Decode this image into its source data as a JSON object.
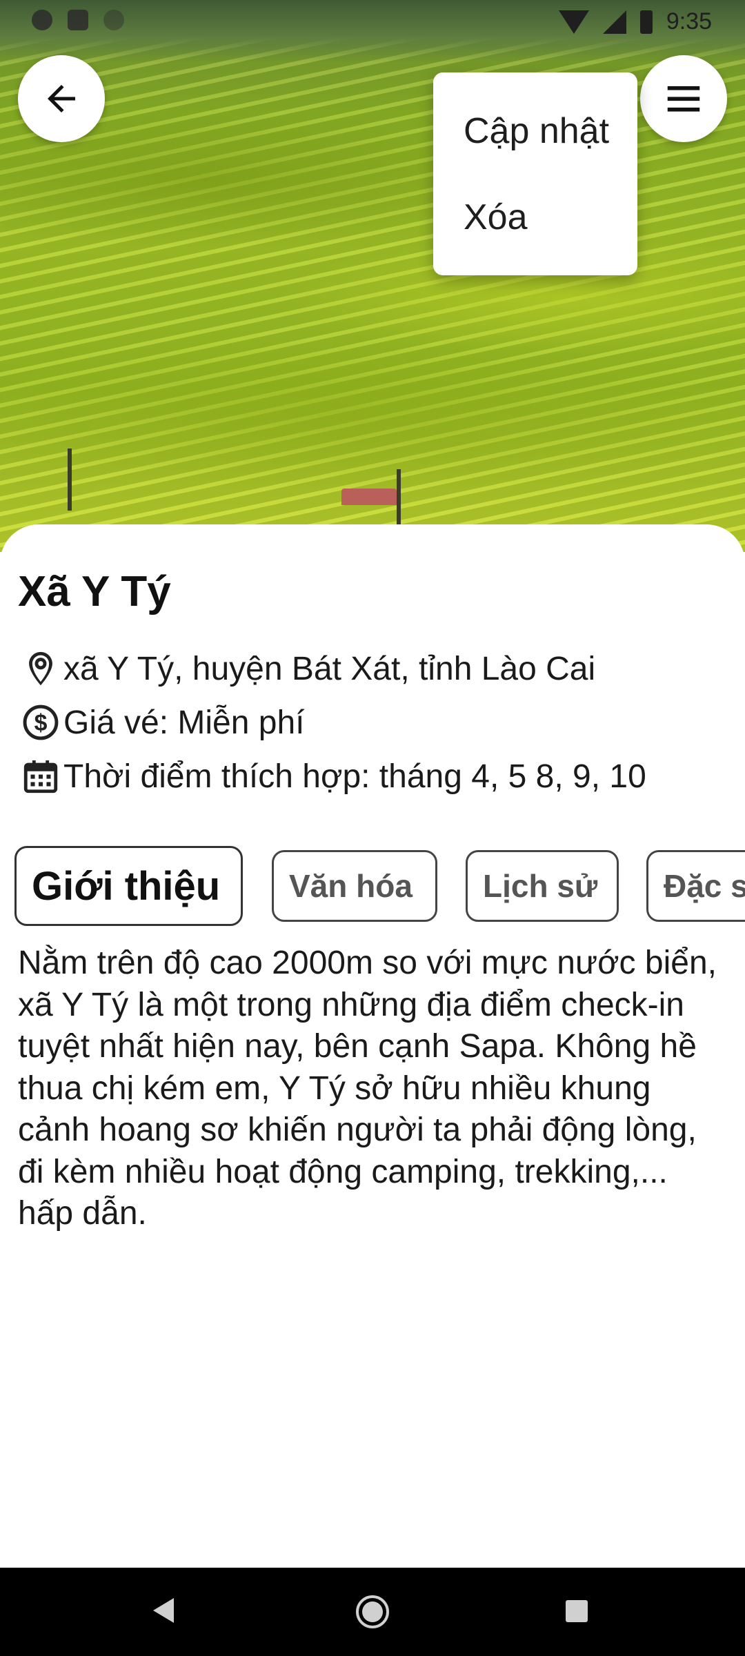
{
  "status_bar": {
    "time": "9:35"
  },
  "hero": {
    "image": "rice-terraces-photo"
  },
  "header": {
    "back_icon": "arrow-left-icon",
    "menu_icon": "hamburger-menu-icon"
  },
  "popup_menu": {
    "items": [
      "Cập nhật",
      "Xóa"
    ]
  },
  "place": {
    "name": "Xã Y Tý",
    "address": "xã Y Tý, huyện Bát Xát, tỉnh Lào Cai",
    "price": "Giá vé: Miễn phí",
    "best_time": "Thời điểm thích hợp: tháng 4, 5 8, 9, 10"
  },
  "tabs": [
    {
      "label": "Giới thiệu",
      "active": true
    },
    {
      "label": "Văn hóa"
    },
    {
      "label": "Lịch sử"
    },
    {
      "label": "Đặc s"
    }
  ],
  "description": "Nằm trên độ cao 2000m so với mực nước biển, xã Y Tý là một trong những địa điểm check-in tuyệt nhất hiện nay, bên cạnh Sapa. Không hề thua chị kém em, Y Tý sở hữu nhiều khung cảnh hoang sơ khiến người ta phải động lòng, đi kèm nhiều hoạt động camping, trekking,... hấp dẫn.",
  "nav_bar": {
    "icons": [
      "nav-back-icon",
      "nav-home-icon",
      "nav-recents-icon"
    ]
  }
}
